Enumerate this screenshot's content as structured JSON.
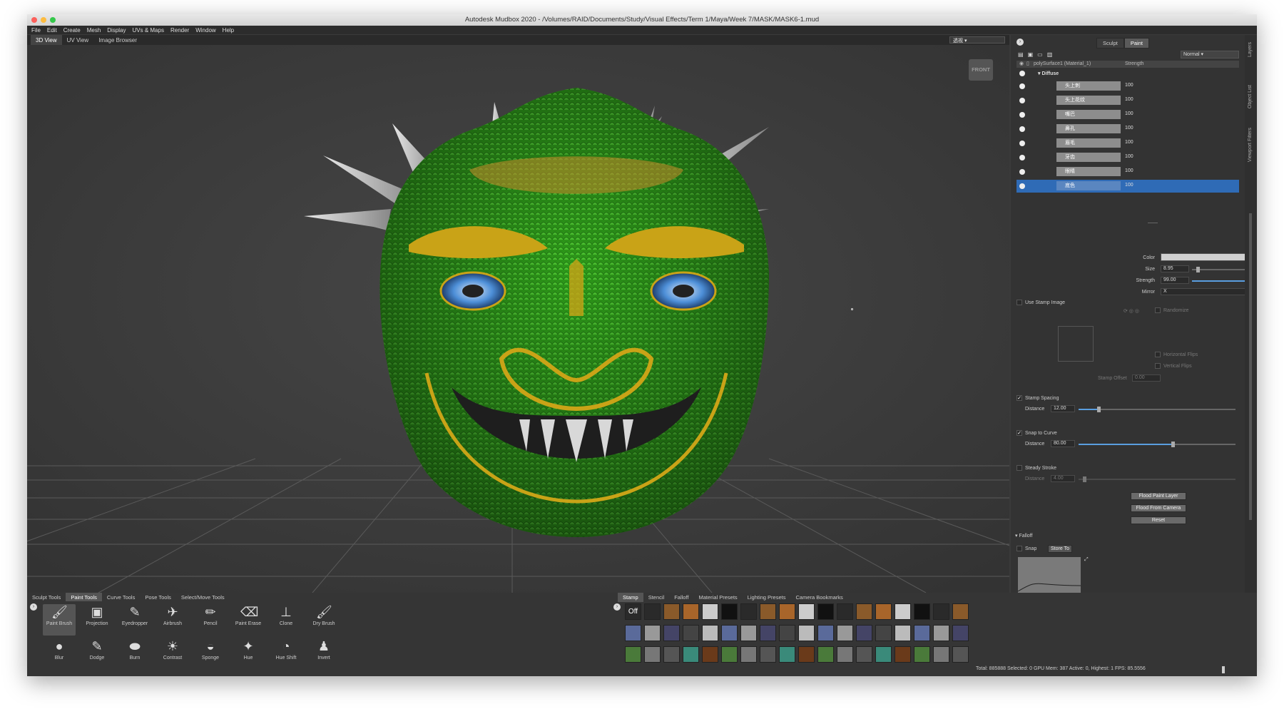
{
  "title": "Autodesk Mudbox 2020 - /Volumes/RAID/Documents/Study/Visual Effects/Term 1/Maya/Week 7/MASK/MASK6-1.mud",
  "menu": [
    "File",
    "Edit",
    "Create",
    "Mesh",
    "Display",
    "UVs & Maps",
    "Render",
    "Window",
    "Help"
  ],
  "view_tabs": [
    "3D View",
    "UV View",
    "Image Browser"
  ],
  "camera": "透视",
  "viewcube": "FRONT",
  "mode_buttons": [
    "Sculpt",
    "Paint"
  ],
  "layers": {
    "blend_mode": "Normal",
    "object": "polySurface1 (Material_1)",
    "strength_header": "Strength",
    "group": "Diffuse",
    "items": [
      {
        "name": "头上刺",
        "value": "100"
      },
      {
        "name": "头上花纹",
        "value": "100"
      },
      {
        "name": "嘴巴",
        "value": "100"
      },
      {
        "name": "鼻孔",
        "value": "100"
      },
      {
        "name": "眉毛",
        "value": "100"
      },
      {
        "name": "牙齿",
        "value": "100"
      },
      {
        "name": "眼睛",
        "value": "100"
      },
      {
        "name": "底色",
        "value": "100"
      }
    ]
  },
  "props": {
    "color_label": "Color",
    "size_label": "Size",
    "size": "8.95",
    "strength_label": "Strength",
    "strength": "99.00",
    "mirror_label": "Mirror",
    "mirror": "X",
    "use_stamp": "Use Stamp Image",
    "randomize": "Randomize",
    "hflip": "Horizontal Flips",
    "vflip": "Vertical Flips",
    "stamp_offset_label": "Stamp Offset",
    "stamp_offset": "0.00",
    "stamp_spacing": "Stamp Spacing",
    "distance_label": "Distance",
    "spacing_distance": "12.00",
    "snap_curve": "Snap to Curve",
    "snap_distance": "80.00",
    "steady": "Steady Stroke",
    "steady_distance": "4.00",
    "flood_layer": "Flood Paint Layer",
    "flood_camera": "Flood From Camera",
    "reset": "Reset",
    "falloff": "Falloff",
    "snap": "Snap",
    "store_to": "Store To"
  },
  "side_labels": [
    "Layers",
    "Object List",
    "Viewport Filters"
  ],
  "tool_tabs": [
    "Sculpt Tools",
    "Paint Tools",
    "Curve Tools",
    "Pose Tools",
    "Select/Move Tools"
  ],
  "tools_row1": [
    "Paint Brush",
    "Projection",
    "Eyedropper",
    "Airbrush",
    "Pencil",
    "Paint Erase",
    "Clone",
    "Dry Brush"
  ],
  "tools_row2": [
    "Blur",
    "Dodge",
    "Burn",
    "Contrast",
    "Sponge",
    "Hue",
    "Hue Shift",
    "Invert"
  ],
  "tray_tabs": [
    "Stamp",
    "Stencil",
    "Falloff",
    "Material Presets",
    "Lighting Presets",
    "Camera Bookmarks"
  ],
  "stamp_off": "Off",
  "status": "Total: 885888  Selected: 0  GPU Mem: 387  Active: 0, Highest: 1  FPS: 85.5556",
  "colors": {
    "accent": "#2f6bb6",
    "mask_green": "#2e9a1a",
    "gold": "#c9a317"
  }
}
